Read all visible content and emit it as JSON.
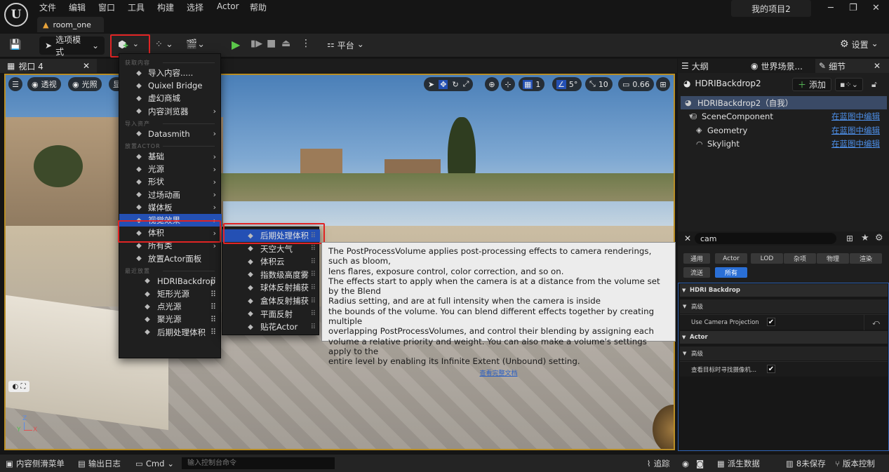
{
  "menubar": {
    "items": [
      "文件",
      "编辑",
      "窗口",
      "工具",
      "构建",
      "选择",
      "Actor",
      "帮助"
    ],
    "project": "我的项目2",
    "tab_label": "room_one"
  },
  "toolbar": {
    "select_mode": "选项模式",
    "platform": "平台",
    "settings": "设置"
  },
  "viewport": {
    "tab_label": "视口 4",
    "view_mode": "透视",
    "lit_mode": "光照",
    "show_trunc": "显",
    "grid_snap": "1",
    "angle_snap": "5°",
    "scale_snap": "10",
    "camera_speed": "0.66"
  },
  "add_menu": {
    "items": [
      {
        "section": "获取内容"
      },
      {
        "label": "导入内容.....",
        "icon": "import-icon"
      },
      {
        "label": "Quixel Bridge",
        "icon": "quixel-icon"
      },
      {
        "label": "虚幻商城",
        "icon": "marketplace-icon"
      },
      {
        "label": "内容浏览器",
        "icon": "content-browser-icon",
        "arrow": true
      },
      {
        "section": "导入资产"
      },
      {
        "label": "Datasmith",
        "icon": "datasmith-icon",
        "arrow": true
      },
      {
        "section": "放置ACTOR"
      },
      {
        "label": "基础",
        "icon": "basic-icon",
        "arrow": true
      },
      {
        "label": "光源",
        "icon": "light-icon",
        "arrow": true
      },
      {
        "label": "形状",
        "icon": "shape-icon",
        "arrow": true
      },
      {
        "label": "过场动画",
        "icon": "cinematic-icon",
        "arrow": true
      },
      {
        "label": "媒体板",
        "icon": "media-icon",
        "arrow": true
      },
      {
        "label": "视觉效果",
        "icon": "visual-effects-icon",
        "arrow": true,
        "highlight": true
      },
      {
        "label": "体积",
        "icon": "volume-icon",
        "arrow": true
      },
      {
        "label": "所有类",
        "icon": "all-classes-icon",
        "arrow": true
      },
      {
        "label": "放置Actor面板",
        "icon": "place-actors-icon"
      },
      {
        "section": "最近放置"
      },
      {
        "label": "HDRIBackdrop",
        "icon": "hdri-icon",
        "dots": true,
        "recent": true
      },
      {
        "label": "矩形光源",
        "icon": "rect-light-icon",
        "dots": true,
        "recent": true
      },
      {
        "label": "点光源",
        "icon": "point-light-icon",
        "dots": true,
        "recent": true
      },
      {
        "label": "聚光源",
        "icon": "spot-light-icon",
        "dots": true,
        "recent": true
      },
      {
        "label": "后期处理体积",
        "icon": "post-process-icon",
        "dots": true,
        "recent": true
      }
    ]
  },
  "visual_submenu": {
    "items": [
      {
        "label": "后期处理体积",
        "icon": "post-process-icon",
        "highlight": true
      },
      {
        "label": "天空大气",
        "icon": "sky-atmosphere-icon"
      },
      {
        "label": "体积云",
        "icon": "volumetric-cloud-icon"
      },
      {
        "label": "指数级高度雾",
        "icon": "height-fog-icon"
      },
      {
        "label": "球体反射捕获",
        "icon": "sphere-reflection-icon"
      },
      {
        "label": "盒体反射捕获",
        "icon": "box-reflection-icon"
      },
      {
        "label": "平面反射",
        "icon": "planar-reflection-icon"
      },
      {
        "label": "贴花Actor",
        "icon": "decal-icon"
      }
    ]
  },
  "tooltip": {
    "lines": [
      "The PostProcessVolume applies post-processing effects to camera renderings, such as bloom,",
      "lens flares, exposure control, color correction, and so on.",
      "The effects start to apply when the camera is at a distance from the volume set by the Blend",
      "Radius setting, and are at full intensity when the camera is inside",
      "the bounds of the volume. You can blend different effects together by creating multiple",
      "overlapping PostProcessVolumes, and control their blending by assigning each",
      "volume a relative priority and weight. You can also make a volume's settings apply to the",
      "entire level by enabling its Infinite Extent (Unbound) setting."
    ],
    "link": "查看完整文档"
  },
  "right_panel": {
    "tabs": [
      "大纲",
      "世界场景...",
      "细节"
    ],
    "actor_name": "HDRIBackdrop2",
    "add_label": "添加",
    "components": [
      {
        "name": "HDRIBackdrop2（自我）",
        "icon": "actor-icon"
      },
      {
        "name": "SceneComponent",
        "icon": "scene-component-icon",
        "link": "在蓝图中编辑"
      },
      {
        "name": "Geometry",
        "icon": "geometry-icon",
        "link": "在蓝图中编辑"
      },
      {
        "name": "Skylight",
        "icon": "skylight-icon",
        "link": "在蓝图中编辑"
      }
    ],
    "search_value": "cam",
    "filters": [
      "通用",
      "Actor",
      "LOD",
      "杂项",
      "物理",
      "渲染",
      "流送",
      "所有"
    ],
    "sections": [
      {
        "title": "HDRI Backdrop",
        "sub": "高级",
        "prop": "Use Camera Projection",
        "checked": true
      },
      {
        "title": "Actor",
        "sub": "高级",
        "prop": "查看目标时寻找摄像机...",
        "checked": true
      }
    ]
  },
  "statusbar": {
    "content_drawer": "内容侧滑菜单",
    "output_log": "输出日志",
    "cmd": "Cmd",
    "console_placeholder": "输入控制台命令",
    "trace": "追踪",
    "derived_data": "派生数据",
    "unsaved": "8未保存",
    "source_control": "版本控制"
  },
  "colors": {
    "accent_blue": "#2450b4",
    "highlight_red": "#e02424",
    "viewport_border": "#b88d25",
    "link_blue": "#4d8fe8"
  }
}
